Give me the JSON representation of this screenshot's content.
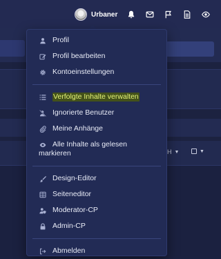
{
  "topbar": {
    "username": "Urbaner",
    "icons": [
      "bell-icon",
      "envelope-icon",
      "flag-icon",
      "document-icon",
      "eye-icon"
    ]
  },
  "background": {
    "filter_label": "H",
    "sort_label": ""
  },
  "menu": {
    "group1": [
      {
        "label": "Profil",
        "icon": "user-icon"
      },
      {
        "label": "Profil bearbeiten",
        "icon": "edit-icon"
      },
      {
        "label": "Kontoeinstellungen",
        "icon": "gear-icon"
      }
    ],
    "group2": [
      {
        "label": "Verfolgte Inhalte verwalten",
        "icon": "list-icon",
        "highlighted": true
      },
      {
        "label": "Ignorierte Benutzer",
        "icon": "user-slash-icon"
      },
      {
        "label": "Meine Anhänge",
        "icon": "paperclip-icon"
      },
      {
        "label": "Alle Inhalte als gelesen markieren",
        "icon": "eye-icon"
      }
    ],
    "group3": [
      {
        "label": "Design-Editor",
        "icon": "brush-icon"
      },
      {
        "label": "Seiteneditor",
        "icon": "table-icon"
      },
      {
        "label": "Moderator-CP",
        "icon": "user-shield-icon"
      },
      {
        "label": "Admin-CP",
        "icon": "lock-icon"
      }
    ],
    "group4": [
      {
        "label": "Abmelden",
        "icon": "sign-out-icon"
      }
    ]
  },
  "colors": {
    "menu_bg": "#222b55",
    "highlight_bg": "#43511a",
    "highlight_text": "#e6f57a"
  }
}
